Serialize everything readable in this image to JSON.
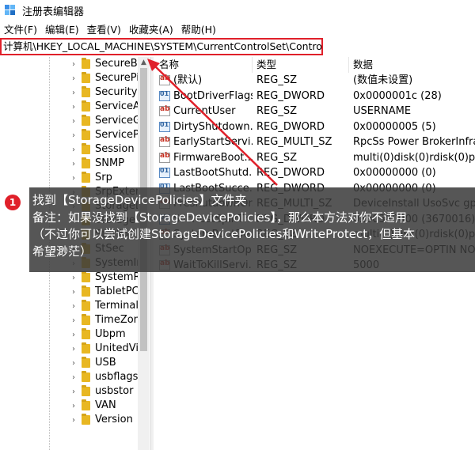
{
  "window": {
    "title": "注册表编辑器"
  },
  "menu": [
    "文件(F)",
    "编辑(E)",
    "查看(V)",
    "收藏夹(A)",
    "帮助(H)"
  ],
  "address": "计算机\\HKEY_LOCAL_MACHINE\\SYSTEM\\CurrentControlSet\\Control",
  "tree": {
    "items": [
      "SecureBo",
      "SecurePi",
      "SecurityP",
      "ServiceA",
      "ServiceG",
      "ServiceP",
      "Session M",
      "SNMP",
      "Srp",
      "SrpExten",
      "StorageD",
      "Storage",
      "StorPort",
      "StSec",
      "SystemIn",
      "SystemR",
      "TabletPC",
      "Terminal",
      "TimeZon",
      "Ubpm",
      "UnitedVi",
      "USB",
      "usbflags",
      "usbstor",
      "VAN",
      "Version"
    ]
  },
  "columns": {
    "name": "名称",
    "type": "类型",
    "data": "数据"
  },
  "values": [
    {
      "icon": "string-value-icon",
      "name": "(默认)",
      "type": "REG_SZ",
      "data": "(数值未设置)"
    },
    {
      "icon": "dword-value-icon",
      "name": "BootDriverFlags",
      "type": "REG_DWORD",
      "data": "0x0000001c (28)"
    },
    {
      "icon": "string-value-icon",
      "name": "CurrentUser",
      "type": "REG_SZ",
      "data": "USERNAME"
    },
    {
      "icon": "dword-value-icon",
      "name": "DirtyShutdown...",
      "type": "REG_DWORD",
      "data": "0x00000005 (5)"
    },
    {
      "icon": "string-value-icon",
      "name": "EarlyStartServi...",
      "type": "REG_MULTI_SZ",
      "data": "RpcSs Power BrokerInfrast"
    },
    {
      "icon": "string-value-icon",
      "name": "FirmwareBoot...",
      "type": "REG_SZ",
      "data": "multi(0)disk(0)rdisk(0)part"
    },
    {
      "icon": "dword-value-icon",
      "name": "LastBootShutd...",
      "type": "REG_DWORD",
      "data": "0x00000000 (0)"
    },
    {
      "icon": "dword-value-icon",
      "name": "LastBootSucce...",
      "type": "REG_DWORD",
      "data": "0x00000000 (0)"
    },
    {
      "icon": "string-value-icon",
      "name": "PreshutdownOr...",
      "type": "REG_MULTI_SZ",
      "data": "DeviceInstall UsoSvc gpsvc"
    },
    {
      "icon": "dword-value-icon",
      "name": "SvcHostSplitTh...",
      "type": "REG_DWORD",
      "data": "0x00380000 (3670016)"
    },
    {
      "icon": "string-value-icon",
      "name": "SystemBootDe...",
      "type": "REG_SZ",
      "data": "multi(0)disk(0)rdisk(0)part"
    },
    {
      "icon": "string-value-icon",
      "name": "SystemStartOp...",
      "type": "REG_SZ",
      "data": " NOEXECUTE=OPTIN NOV"
    },
    {
      "icon": "string-value-icon",
      "name": "WaitToKillServi...",
      "type": "REG_SZ",
      "data": "5000"
    }
  ],
  "annotation": {
    "step": "1",
    "lines": [
      "找到【StorageDevicePolicies】文件夹",
      "备注：如果没找到【StorageDevicePolicies】，那么本方法对你不适用",
      "（不过你可以尝试创建StorageDevicePolicies和WriteProtect，但基本",
      "希望渺茫）"
    ]
  },
  "colors": {
    "highlight": "#e0202a",
    "folder": "#e8b722",
    "overlay": "#3a3a3a"
  }
}
